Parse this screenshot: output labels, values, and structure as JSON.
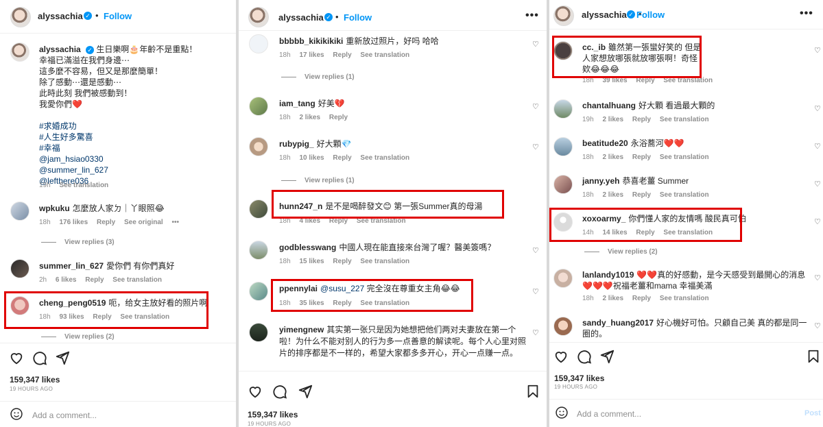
{
  "header": {
    "username": "alyssachia",
    "follow_label": "Follow",
    "dot": "•",
    "more": "•••"
  },
  "caption": {
    "username": "alyssachia",
    "lines": [
      "生日樂啊🎂年齡不是重點！",
      "幸福已滿溢在我們身邊⋯",
      "這多麼不容易，但又是那麼簡單！",
      "除了感動⋯還是感動⋯",
      "此時此刻 我們被感動到！",
      "我愛你們❤️"
    ],
    "hashtags": [
      "#求婚成功",
      "#人生好多驚喜",
      "#幸福"
    ],
    "mentions": [
      "@jam_hsiao0330",
      "@summer_lin_627",
      "@lefthere036"
    ],
    "time": "19h",
    "see_translation": "See translation"
  },
  "panel1": {
    "comments": [
      {
        "user": "wpkuku",
        "text": "怎麼放人家ㄉ｜丫眼照😂",
        "time": "18h",
        "likes": "176 likes",
        "reply": "Reply",
        "extra": "See original",
        "more": "•••"
      },
      {
        "user": "summer_lin_627",
        "text": "愛你們 有你們真好",
        "time": "2h",
        "likes": "6 likes",
        "reply": "Reply",
        "extra": "See translation"
      },
      {
        "user": "cheng_peng0519",
        "text": "呃，给女主放好看的照片啊",
        "time": "18h",
        "likes": "93 likes",
        "reply": "Reply",
        "extra": "See translation"
      }
    ],
    "view_replies": [
      "View replies (3)",
      "View replies (2)"
    ],
    "likes": "159,347 likes",
    "ago": "19 HOURS AGO",
    "add_comment": "Add a comment..."
  },
  "panel2": {
    "comments": [
      {
        "user": "bbbbb_kikikikiki",
        "text": "重新放过照片，好吗 哈哈",
        "time": "18h",
        "likes": "17 likes",
        "reply": "Reply",
        "extra": "See translation"
      },
      {
        "user": "iam_tang",
        "text": "好美💔",
        "time": "18h",
        "likes": "2 likes",
        "reply": "Reply",
        "extra": ""
      },
      {
        "user": "rubypig_",
        "text": "好大顆💎",
        "time": "18h",
        "likes": "10 likes",
        "reply": "Reply",
        "extra": "See translation"
      },
      {
        "user": "hunn247_n",
        "text": "是不是喝醉發文😊 第一張Summer真的母湯",
        "time": "18h",
        "likes": "4 likes",
        "reply": "Reply",
        "extra": "See translation"
      },
      {
        "user": "godblesswang",
        "text": "中國人現在能直接來台灣了喔？醫美簽嗎？",
        "time": "18h",
        "likes": "15 likes",
        "reply": "Reply",
        "extra": "See translation"
      },
      {
        "user": "ppennylai",
        "mention": "@susu_227",
        "text": "完全沒在尊重女主角😂😂",
        "time": "18h",
        "likes": "35 likes",
        "reply": "Reply",
        "extra": "See translation"
      },
      {
        "user": "yimengnew",
        "text": "其实第一张只是因为她想把他们两对夫妻放在第一个啦！为什么不能对别人的行为多一点善意的解读呢。每个人心里对照片的排序都是不一样的，希望大家都多多开心，开心一点赚一点。"
      }
    ],
    "view_replies": [
      "View replies (1)",
      "View replies (1)"
    ],
    "likes": "159,347 likes",
    "ago": "19 HOURS AGO"
  },
  "panel3": {
    "comments": [
      {
        "user": "cc._ib",
        "text": "雖然第一張蠻好笑的 但是人家想放哪張就放哪張啊！奇怪欸😂😂😂",
        "time": "18h",
        "likes": "39 likes",
        "reply": "Reply",
        "extra": "See translation"
      },
      {
        "user": "chantalhuang",
        "text": "好大顆 看過最大顆的",
        "time": "19h",
        "likes": "2 likes",
        "reply": "Reply",
        "extra": "See translation"
      },
      {
        "user": "beatitude20",
        "text": "永浴蕎河❤️❤️",
        "time": "18h",
        "likes": "2 likes",
        "reply": "Reply",
        "extra": "See translation"
      },
      {
        "user": "janny.yeh",
        "text": "恭喜老薑 Summer",
        "time": "18h",
        "likes": "2 likes",
        "reply": "Reply",
        "extra": "See translation"
      },
      {
        "user": "xoxoarmy_",
        "text": "你們懂人家的友情嗎 酸民真可怕",
        "time": "14h",
        "likes": "14 likes",
        "reply": "Reply",
        "extra": "See translation"
      },
      {
        "user": "lanlandy1019",
        "text": "❤️❤️真的好感動，是今天感受到最開心的消息❤️❤️❤️祝福老薑和mama 幸福美滿",
        "time": "18h",
        "likes": "2 likes",
        "reply": "Reply",
        "extra": "See translation"
      },
      {
        "user": "sandy_huang2017",
        "text": "好心機好可怕。只顧自己美 真的都是同一圈的。"
      }
    ],
    "view_replies": [
      "View replies (2)"
    ],
    "likes": "159,347 likes",
    "ago": "19 HOURS AGO",
    "add_comment": "Add a comment...",
    "post": "Post"
  },
  "colors": {
    "highlight": "#e00000",
    "link": "#0095f6",
    "muted": "#8e8e8e"
  }
}
